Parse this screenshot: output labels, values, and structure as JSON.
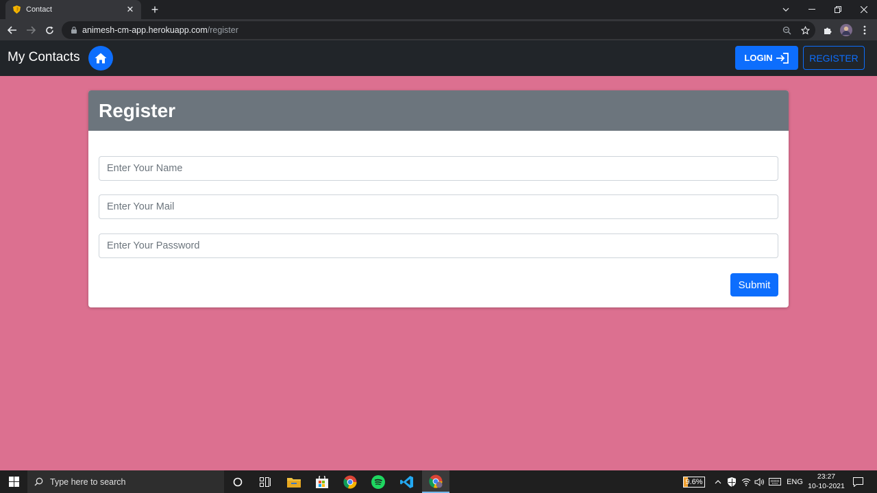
{
  "browser": {
    "tab_title": "Contact",
    "url_domain": "animesh-cm-app.herokuapp.com",
    "url_path": "/register"
  },
  "navbar": {
    "brand": "My Contacts",
    "login_label": "LOGIN",
    "register_label": "REGISTER"
  },
  "card": {
    "title": "Register",
    "fields": [
      {
        "placeholder": "Enter Your Name",
        "value": ""
      },
      {
        "placeholder": "Enter Your Mail",
        "value": ""
      },
      {
        "placeholder": "Enter Your Password",
        "value": ""
      }
    ],
    "submit_label": "Submit"
  },
  "taskbar": {
    "search_placeholder": "Type here to search",
    "battery": "9.6%",
    "language": "ENG",
    "time": "23:27",
    "date": "10-10-2021"
  },
  "colors": {
    "page_bg": "#dc7090",
    "navbar_bg": "#212529",
    "primary": "#0d6efd",
    "card_header": "#6c757d"
  }
}
